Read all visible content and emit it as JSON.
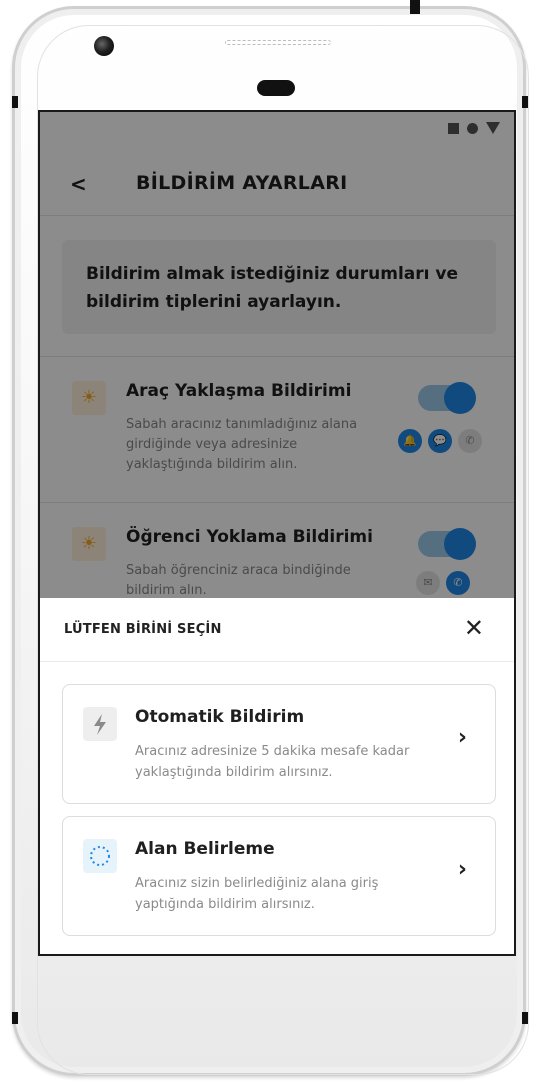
{
  "header": {
    "back_icon": "chevron-left-icon",
    "title": "BİLDİRİM AYARLARI"
  },
  "info": {
    "text": "Bildirim almak istediğiniz durumları ve bildirim tiplerini ayarlayın."
  },
  "settings": [
    {
      "icon": "sun-icon",
      "title": "Araç Yaklaşma Bildirimi",
      "description": "Sabah aracınız tanımladığınız alana girdiğinde veya adresinize yaklaştığında bildirim alın.",
      "enabled": true,
      "channels": [
        "bell-icon",
        "chat-icon",
        "phone-icon"
      ]
    },
    {
      "icon": "sun-icon",
      "title": "Öğrenci Yoklama Bildirimi",
      "description": "Sabah öğrenciniz araca bindiğinde bildirim alın.",
      "enabled": true,
      "channels": [
        "message-icon",
        "phone-icon"
      ]
    }
  ],
  "sheet": {
    "title": "LÜTFEN BİRİNİ SEÇİN",
    "close_icon": "close-icon",
    "options": [
      {
        "icon": "lightning-icon",
        "title": "Otomatik Bildirim",
        "description": "Aracınız adresinize 5 dakika mesafe kadar yaklaştığında bildirim alırsınız."
      },
      {
        "icon": "area-circle-icon",
        "title": "Alan Belirleme",
        "description": "Aracınız sizin belirlediğiniz alana giriş yaptığında bildirim alırsınız."
      }
    ]
  },
  "colors": {
    "accent": "#1e88e5",
    "toggle_track": "#9bc8ea",
    "overlay": "rgba(0,0,0,0.45)",
    "icon_sun": "#f5a623"
  }
}
